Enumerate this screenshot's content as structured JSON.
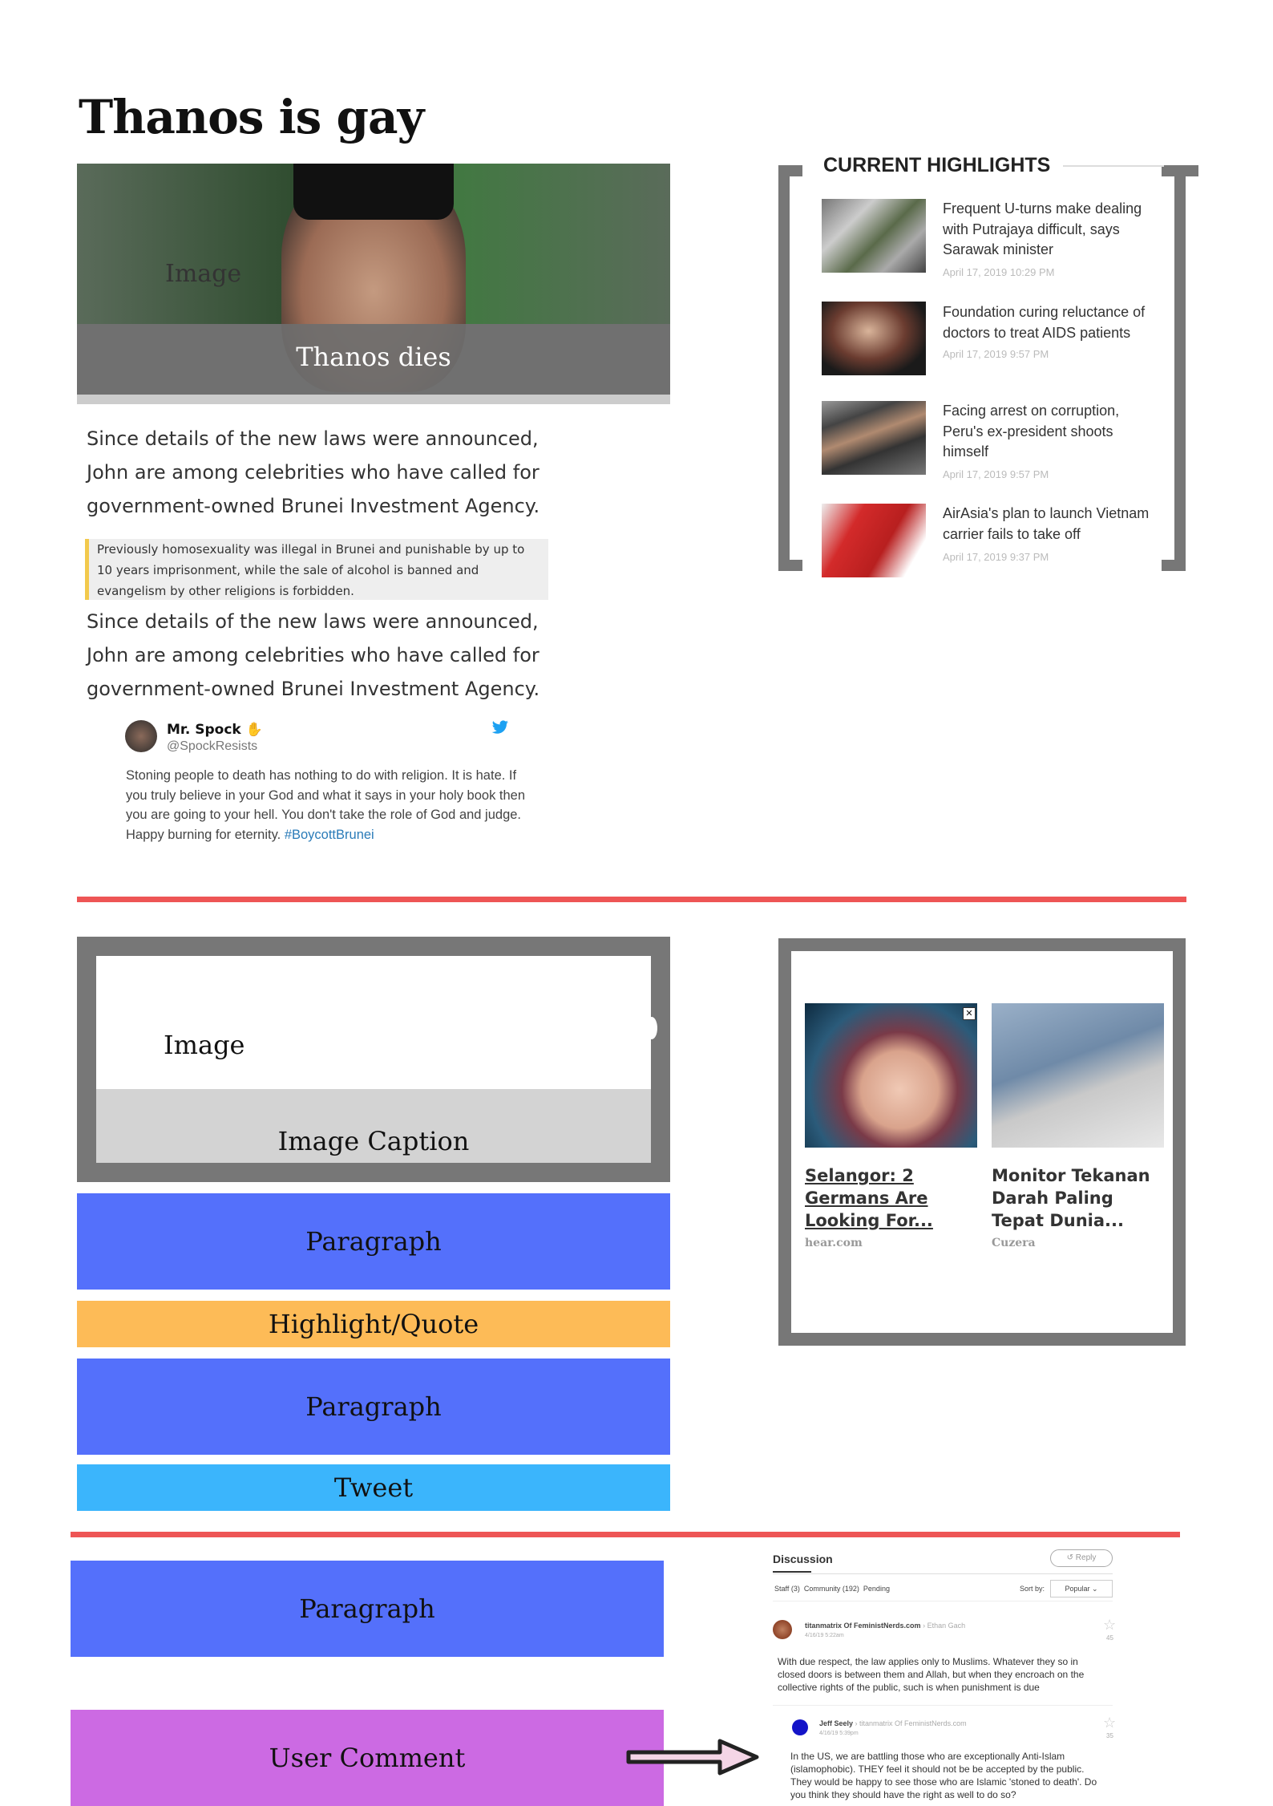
{
  "title": "Thanos is gay",
  "hero": {
    "image_label": "Image",
    "caption": "Thanos dies"
  },
  "paragraph_1": "Since details of the new laws were announced, John are among celebrities who have called for government-owned Brunei Investment Agency.",
  "quote": "Previously homosexuality was illegal in Brunei and punishable by up to 10 years imprisonment, while the sale of alcohol is banned and evangelism by other religions is forbidden.",
  "paragraph_2": "Since details of the new laws were announced, John are among celebrities who have called for government-owned Brunei Investment Agency.",
  "tweet": {
    "name": "Mr. Spock",
    "handle": "@SpockResists",
    "text": "Stoning people to death has nothing to do with religion. It is hate. If you truly believe in your God and what it says in your holy book then you are going to your hell. You don't take the role of God and judge.",
    "text_2": "Happy burning for eternity.",
    "hashtag": "#BoycottBrunei"
  },
  "highlights": {
    "title": "CURRENT HIGHLIGHTS",
    "items": [
      {
        "text": "Frequent U-turns make dealing with Putrajaya difficult, says Sarawak minister",
        "date": "April 17, 2019 10:29 PM"
      },
      {
        "text": "Foundation curing reluctance of doctors to treat AIDS patients",
        "date": "April 17, 2019 9:57 PM"
      },
      {
        "text": "Facing arrest on corruption, Peru's ex-president shoots himself",
        "date": "April 17, 2019 9:57 PM"
      },
      {
        "text": "AirAsia's plan to launch Vietnam carrier fails to take off",
        "date": "April 17, 2019 9:37 PM"
      }
    ]
  },
  "wireframe": {
    "image": "Image",
    "image_caption": "Image Caption",
    "paragraph": "Paragraph",
    "highlight": "Highlight/Quote",
    "tweet": "Tweet",
    "user_comment": "User Comment"
  },
  "ads": [
    {
      "title": "Selangor: 2 Germans Are Looking For...",
      "source": "hear.com"
    },
    {
      "title": "Monitor Tekanan Darah Paling Tepat Dunia...",
      "source": "Cuzera"
    }
  ],
  "discussion": {
    "title": "Discussion",
    "reply": "Reply",
    "tabs": [
      "Staff (3)",
      "Community (192)",
      "Pending"
    ],
    "sort_label": "Sort by:",
    "sort_value": "Popular",
    "comments": [
      {
        "author": "titanmatrix Of FeministNerds.com",
        "reply_to": "Ethan Gach",
        "date": "4/16/19 5:22am",
        "likes": "45",
        "text": "With due respect, the law applies only to Muslims. Whatever they so in closed doors is between them and Allah, but when they encroach on the collective rights of the public, such is when punishment is due"
      },
      {
        "author": "Jeff Seely",
        "reply_to": "titanmatrix Of FeministNerds.com",
        "date": "4/16/19 5:39pm",
        "likes": "35",
        "text": "In the US, we are battling those who are exceptionally Anti-Islam (islamophobic). THEY feel it should not be be accepted by the public. They would be happy to see those who are Islamic 'stoned to death'. Do you think they should have the right as well to do so?"
      }
    ]
  },
  "colors": {
    "accent_red": "#ee5555",
    "paragraph_blue": "#5470fb",
    "highlight_orange": "#fdbb57",
    "tweet_blue": "#3bb5fc",
    "comment_purple": "#cc6ae3"
  }
}
